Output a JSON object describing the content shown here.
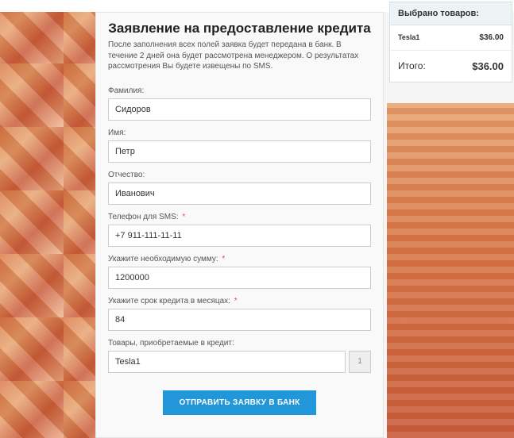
{
  "form": {
    "title": "Заявление на предоставление кредита",
    "description": "После заполнения всех полей заявка будет передана в банк. В течение 2 дней она будет рассмотрена менеджером. О результатах рассмотрения Вы будете извещены по SMS.",
    "fields": {
      "surname": {
        "label": "Фамилия:",
        "value": "Сидоров"
      },
      "name": {
        "label": "Имя:",
        "value": "Петр"
      },
      "patronymic": {
        "label": "Отчество:",
        "value": "Иванович"
      },
      "phone": {
        "label": "Телефон для SMS:",
        "value": "+7 911-111-11-11"
      },
      "amount": {
        "label": "Укажите необходимую сумму:",
        "value": "1200000"
      },
      "term": {
        "label": "Укажите срок кредита в месяцах:",
        "value": "84"
      },
      "goods": {
        "label": "Товары, приобретаемые в кредит:",
        "value": "Tesla1",
        "qty": "1"
      }
    },
    "required_mark": "*",
    "submit_label": "ОТПРАВИТЬ ЗАЯВКУ В БАНК"
  },
  "cart": {
    "header": "Выбрано товаров:",
    "items": [
      {
        "name": "Tesla1",
        "price": "$36.00"
      }
    ],
    "total_label": "Итого:",
    "total_price": "$36.00"
  }
}
